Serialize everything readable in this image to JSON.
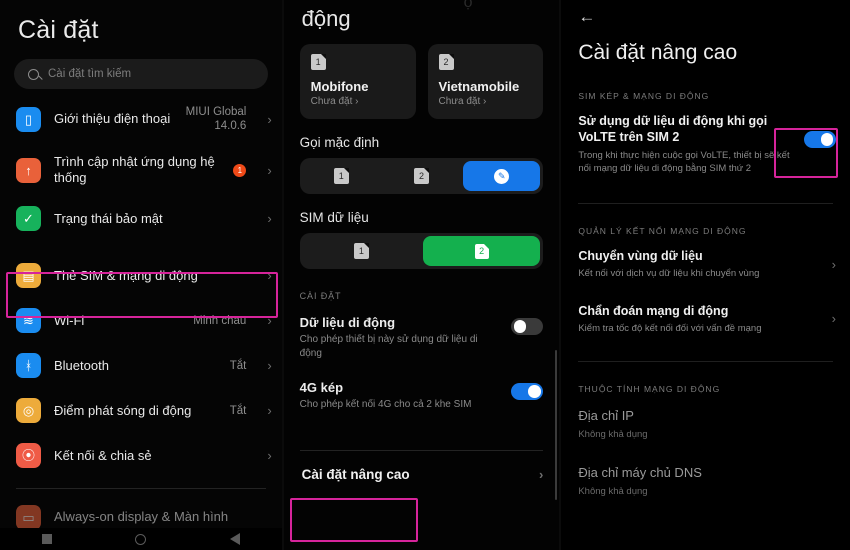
{
  "accent": {
    "highlight": "#d6249b",
    "blue": "#1677e8",
    "green": "#14b04e",
    "orange": "#f04a18"
  },
  "left": {
    "title": "Cài đặt",
    "search": {
      "placeholder": "Cài đặt tìm kiếm",
      "icon": "search-icon"
    },
    "items": [
      {
        "label": "Giới thiệu điện thoại",
        "value": "MIUI Global\n14.0.6",
        "icon": "phone-icon",
        "icon_color": "#1a8cf0",
        "glyph": "▯",
        "badge": "",
        "chevron": "›"
      },
      {
        "label": "Trình cập nhật ứng dụng hệ thống",
        "value": "",
        "icon": "update-arrow-icon",
        "icon_color": "#e9613a",
        "glyph": "↑",
        "badge": "1",
        "chevron": "›"
      },
      {
        "label": "Trạng thái bảo mật",
        "value": "",
        "icon": "shield-check-icon",
        "icon_color": "#17b25c",
        "glyph": "✓",
        "badge": "",
        "chevron": "›"
      },
      {
        "label": "Thẻ SIM & mạng di động",
        "value": "",
        "icon": "sim-card-icon",
        "icon_color": "#edab3b",
        "glyph": "▤",
        "badge": "",
        "chevron": "›",
        "highlighted": true
      },
      {
        "label": "Wi-Fi",
        "value": "Minh chau",
        "icon": "wifi-icon",
        "icon_color": "#1a8cf0",
        "glyph": "≋",
        "badge": "",
        "chevron": "›"
      },
      {
        "label": "Bluetooth",
        "value": "Tắt",
        "icon": "bluetooth-icon",
        "icon_color": "#1a8cf0",
        "glyph": "ᚼ",
        "badge": "",
        "chevron": "›"
      },
      {
        "label": "Điểm phát sóng di động",
        "value": "Tắt",
        "icon": "hotspot-icon",
        "icon_color": "#edab3b",
        "glyph": "◎",
        "badge": "",
        "chevron": "›"
      },
      {
        "label": "Kết nối & chia sẻ",
        "value": "",
        "icon": "share-connect-icon",
        "icon_color": "#ef5b46",
        "glyph": "⦿",
        "badge": "",
        "chevron": "›"
      }
    ],
    "cut_item": {
      "label": "Always-on display & Màn hình",
      "icon": "display-icon",
      "icon_color": "#e9613a"
    },
    "navbar": [
      "recents-icon",
      "home-icon",
      "back-icon"
    ]
  },
  "middle": {
    "header": "động",
    "header_ghost": "ộ",
    "sim_cards": [
      {
        "slot": "1",
        "name": "Mobifone",
        "sub": "Chưa đặt ›"
      },
      {
        "slot": "2",
        "name": "Vietnamobile",
        "sub": "Chưa đặt ›"
      }
    ],
    "default_call": {
      "title": "Gọi mặc định",
      "segments": [
        {
          "label": "1",
          "state": "inactive",
          "type": "sim"
        },
        {
          "label": "2",
          "state": "inactive",
          "type": "sim"
        },
        {
          "label": "",
          "state": "active-blue",
          "type": "pencil",
          "icon": "pencil-icon"
        }
      ]
    },
    "data_sim": {
      "title": "SIM dữ liệu",
      "segments": [
        {
          "label": "1",
          "state": "inactive",
          "type": "sim"
        },
        {
          "label": "2",
          "state": "active-green",
          "type": "sim"
        }
      ]
    },
    "settings_caption": "CÀI ĐẶT",
    "options": [
      {
        "title": "Dữ liệu di động",
        "sub": "Cho phép thiết bị này sử dụng dữ liệu di động",
        "toggle": "off"
      },
      {
        "title": "4G kép",
        "sub": "Cho phép kết nối 4G cho cả 2 khe SIM",
        "toggle": "on"
      }
    ],
    "advanced": {
      "label": "Cài đặt nâng cao",
      "chevron": "›",
      "highlighted": true
    }
  },
  "right": {
    "back": "←",
    "title": "Cài đặt nâng cao",
    "section1_caption": "SIM KÉP & MẠNG DI ĐỘNG",
    "volte": {
      "title": "Sử dụng dữ liệu di động khi gọi VoLTE trên SIM 2",
      "sub": "Trong khi thực hiện cuộc gọi VoLTE, thiết bị sẽ kết nối mạng dữ liệu di động bằng SIM thứ 2",
      "toggle": "on",
      "highlighted": true
    },
    "section2_caption": "QUẢN LÝ KẾT NỐI MẠNG DI ĐỘNG",
    "manage_rows": [
      {
        "title": "Chuyển vùng dữ liệu",
        "sub": "Kết nối với dịch vụ dữ liệu khi chuyển vùng",
        "chevron": "›"
      },
      {
        "title": "Chẩn đoán mạng di động",
        "sub": "Kiểm tra tốc độ kết nối đối với vấn đề mạng",
        "chevron": "›"
      }
    ],
    "section3_caption": "THUỘC TÍNH MẠNG DI ĐỘNG",
    "props": [
      {
        "title": "Địa chỉ IP",
        "sub": "Không khả dụng"
      },
      {
        "title": "Địa chỉ máy chủ DNS",
        "sub": "Không khả dụng"
      }
    ]
  }
}
